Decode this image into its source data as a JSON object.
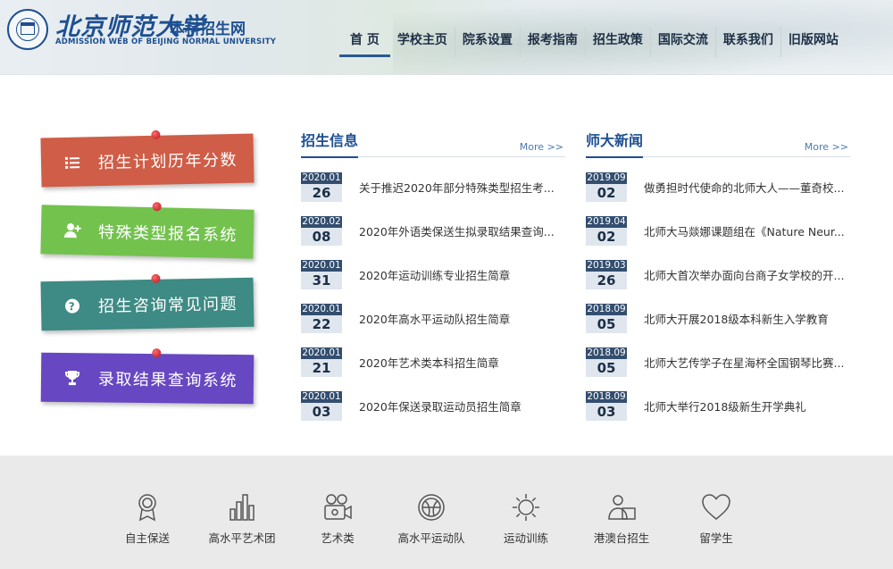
{
  "header": {
    "logo_cn": "北京师范大学",
    "logo_sub": "本科招生网",
    "logo_en": "ADMISSION WEB OF BEIJING NORMAL UNIVERSITY"
  },
  "nav": [
    "首 页",
    "学校主页",
    "院系设置",
    "报考指南",
    "招生政策",
    "国际交流",
    "联系我们",
    "旧版网站"
  ],
  "quick_links": [
    {
      "label": "招生计划历年分数",
      "icon": "list-icon",
      "color": "#cf5d47"
    },
    {
      "label": "特殊类型报名系统",
      "icon": "user-add-icon",
      "color": "#73c24e"
    },
    {
      "label": "招生咨询常见问题",
      "icon": "question-icon",
      "color": "#3e8a84"
    },
    {
      "label": "录取结果查询系统",
      "icon": "trophy-icon",
      "color": "#6747c2"
    }
  ],
  "admission_info": {
    "title": "招生信息",
    "more": "More >>",
    "items": [
      {
        "ym": "2020.01",
        "day": "26",
        "title": "关于推迟2020年部分特殊类型招生考..."
      },
      {
        "ym": "2020.02",
        "day": "08",
        "title": "2020年外语类保送生拟录取结果查询..."
      },
      {
        "ym": "2020.01",
        "day": "31",
        "title": "2020年运动训练专业招生简章"
      },
      {
        "ym": "2020.01",
        "day": "22",
        "title": "2020年高水平运动队招生简章"
      },
      {
        "ym": "2020.01",
        "day": "21",
        "title": "2020年艺术类本科招生简章"
      },
      {
        "ym": "2020.01",
        "day": "03",
        "title": "2020年保送录取运动员招生简章"
      }
    ]
  },
  "university_news": {
    "title": "师大新闻",
    "more": "More >>",
    "items": [
      {
        "ym": "2019.09",
        "day": "02",
        "title": "做勇担时代使命的北师大人——董奇校..."
      },
      {
        "ym": "2019.04",
        "day": "02",
        "title": "北师大马燚娜课题组在《Nature Neur..."
      },
      {
        "ym": "2019.03",
        "day": "26",
        "title": "北师大首次举办面向台商子女学校的开..."
      },
      {
        "ym": "2018.09",
        "day": "05",
        "title": "北师大开展2018级本科新生入学教育"
      },
      {
        "ym": "2018.09",
        "day": "05",
        "title": "北师大艺传学子在星海杯全国钢琴比赛..."
      },
      {
        "ym": "2018.09",
        "day": "03",
        "title": "北师大举行2018级新生开学典礼"
      }
    ]
  },
  "categories": [
    {
      "label": "自主保送",
      "icon": "medal-icon"
    },
    {
      "label": "高水平艺术团",
      "icon": "bar-chart-icon"
    },
    {
      "label": "艺术类",
      "icon": "camera-icon"
    },
    {
      "label": "高水平运动队",
      "icon": "ball-icon"
    },
    {
      "label": "运动训练",
      "icon": "sun-icon"
    },
    {
      "label": "港澳台招生",
      "icon": "people-icon"
    },
    {
      "label": "留学生",
      "icon": "heart-icon"
    }
  ]
}
